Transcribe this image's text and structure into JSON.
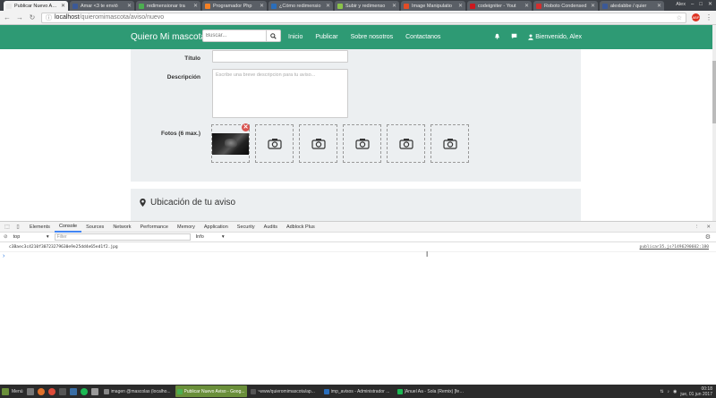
{
  "browser": {
    "tabs": [
      {
        "title": "Publicar Nuevo Aviso",
        "color": "#e8e8e8",
        "active": true
      },
      {
        "title": "Amar <3 te envió",
        "color": "#3b5998"
      },
      {
        "title": "redimensionar tra",
        "color": "#4caf50"
      },
      {
        "title": "Programador Php",
        "color": "#f48024"
      },
      {
        "title": "¿Cómo redimensio",
        "color": "#2a6ebb"
      },
      {
        "title": "Subir y redimenso",
        "color": "#8bc34a"
      },
      {
        "title": "Image Manipulatio",
        "color": "#e34c26"
      },
      {
        "title": "codeigniter - Yout",
        "color": "#cc181e"
      },
      {
        "title": "Roboto Condensed",
        "color": "#d32f2f"
      },
      {
        "title": "alexlabbe / quier",
        "color": "#3b5998"
      }
    ],
    "user": "Alex",
    "url_host": "localhost",
    "url_path": "/quieromimascota/aviso/nuevo",
    "ext_badge": "ABP"
  },
  "site": {
    "brand": "Quiero Mi mascota",
    "search_placeholder": "Buscar...",
    "nav": [
      "Inicio",
      "Publicar",
      "Sobre nosotros",
      "Contactanos"
    ],
    "welcome": "Bienvenido, Alex",
    "accent": "#2e9a74"
  },
  "form": {
    "titulo_label": "Título",
    "descripcion_label": "Descripción",
    "descripcion_placeholder": "Escribe una breve descripcion para tu aviso...",
    "fotos_label": "Fotos (6 max.)",
    "photo_slots": 6,
    "filled_slots": 1,
    "delete_glyph": "✕"
  },
  "ubicacion": {
    "title": "Ubicación de tu aviso"
  },
  "devtools": {
    "tabs": [
      "Elements",
      "Console",
      "Sources",
      "Network",
      "Performance",
      "Memory",
      "Application",
      "Security",
      "Audits",
      "Adblock Plus"
    ],
    "active_tab": "Console",
    "context": "top",
    "filter_placeholder": "Filter",
    "level": "Info",
    "log_message": "c3Baec3c4210f30723279630e9e25dd4e65ed1f2.jpg",
    "log_source": "publicar35.js?1496290602:180",
    "prompt": "›"
  },
  "taskbar": {
    "menu": "Menú",
    "tasks": [
      {
        "label": "imagen @mascolas (localho...",
        "color": "#888"
      },
      {
        "label": "Publicar Nuevo Aviso - Goog...",
        "color": "#4caf50",
        "active": true
      },
      {
        "label": "~www/quieromimascota/ap...",
        "color": "#555"
      },
      {
        "label": "tmp_avisos - Administrador ...",
        "color": "#2a6ebb"
      },
      {
        "label": "[Anuel Aa - Sola (Remix) [fea...",
        "color": "#1db954"
      }
    ],
    "time": "00:18",
    "date": "jue, 01 jun 2017"
  }
}
